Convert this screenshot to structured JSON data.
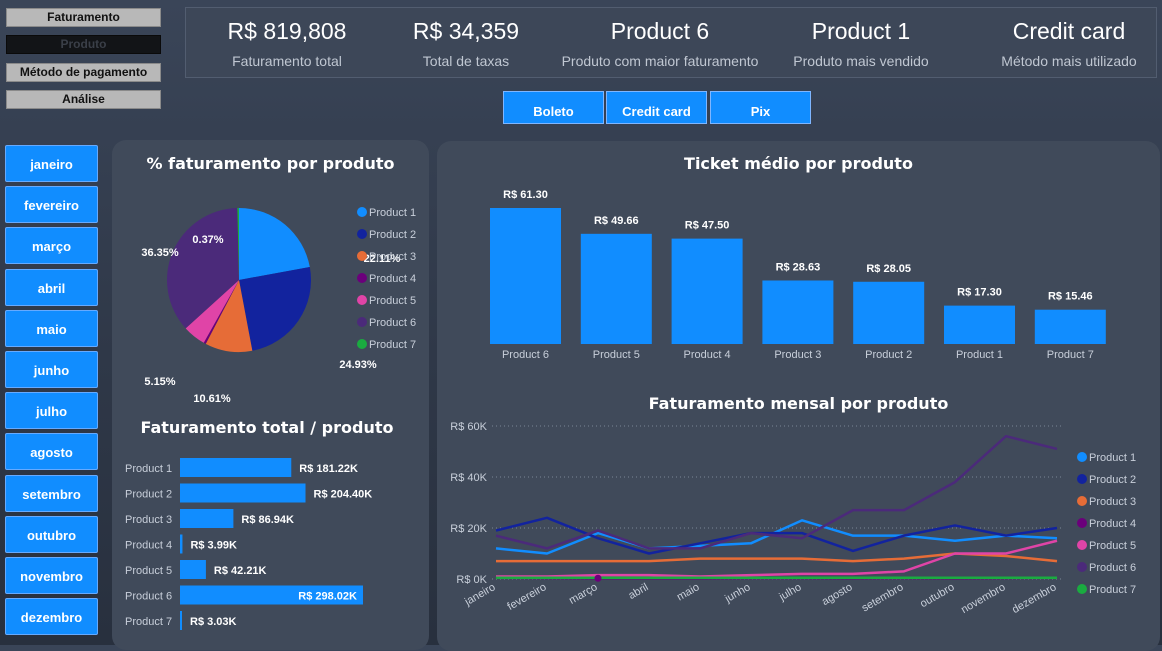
{
  "nav": {
    "items": [
      {
        "label": "Faturamento",
        "active": false
      },
      {
        "label": "Produto",
        "active": true
      },
      {
        "label": "Método de pagamento",
        "active": false
      },
      {
        "label": "Análise",
        "active": false
      }
    ]
  },
  "kpis": [
    {
      "value": "R$ 819,808",
      "label": "Faturamento total"
    },
    {
      "value": "R$ 34,359",
      "label": "Total de taxas"
    },
    {
      "value": "Product 6",
      "label": "Produto com maior faturamento"
    },
    {
      "value": "Product 1",
      "label": "Produto mais vendido"
    },
    {
      "value": "Credit card",
      "label": "Método mais utilizado"
    }
  ],
  "payment_buttons": [
    "Boleto",
    "Credit card",
    "Pix"
  ],
  "months": [
    "janeiro",
    "fevereiro",
    "março",
    "abril",
    "maio",
    "junho",
    "julho",
    "agosto",
    "setembro",
    "outubro",
    "novembro",
    "dezembro"
  ],
  "colors": {
    "Product 1": "#118dff",
    "Product 2": "#12239e",
    "Product 3": "#e66c37",
    "Product 4": "#6b007b",
    "Product 5": "#e044a7",
    "Product 6": "#4b2a7a",
    "Product 7": "#1aab40"
  },
  "chart_data": [
    {
      "type": "pie",
      "title": "% faturamento por produto",
      "legend": [
        "Product 1",
        "Product 2",
        "Product 3",
        "Product 4",
        "Product 5",
        "Product 6",
        "Product 7"
      ],
      "values": [
        22.11,
        24.93,
        10.61,
        0.49,
        5.15,
        36.35,
        0.37
      ],
      "labels": [
        "22.11%",
        "24.93%",
        "10.61%",
        "",
        "5.15%",
        "36.35%",
        "0.37%"
      ],
      "legend_position": "right"
    },
    {
      "type": "bar",
      "orientation": "horizontal",
      "title": "Faturamento total / produto",
      "categories": [
        "Product 1",
        "Product 2",
        "Product 3",
        "Product 4",
        "Product 5",
        "Product 6",
        "Product 7"
      ],
      "values": [
        181.22,
        204.4,
        86.94,
        3.99,
        42.21,
        298.02,
        3.03
      ],
      "labels": [
        "R$ 181.22K",
        "R$ 204.40K",
        "R$ 86.94K",
        "R$ 3.99K",
        "R$ 42.21K",
        "R$ 298.02K",
        "R$ 3.03K"
      ]
    },
    {
      "type": "bar",
      "title": "Ticket médio por produto",
      "categories": [
        "Product 6",
        "Product 5",
        "Product 4",
        "Product 3",
        "Product 2",
        "Product 1",
        "Product 7"
      ],
      "values": [
        61.3,
        49.66,
        47.5,
        28.63,
        28.05,
        17.3,
        15.46
      ],
      "labels": [
        "R$ 61.30",
        "R$ 49.66",
        "R$ 47.50",
        "R$ 28.63",
        "R$ 28.05",
        "R$ 17.30",
        "R$ 15.46"
      ]
    },
    {
      "type": "line",
      "title": "Faturamento mensal por produto",
      "x": [
        "janeiro",
        "fevereiro",
        "março",
        "abril",
        "maio",
        "junho",
        "julho",
        "agosto",
        "setembro",
        "outubro",
        "novembro",
        "dezembro"
      ],
      "yticks": [
        "R$ 0K",
        "R$ 20K",
        "R$ 40K",
        "R$ 60K"
      ],
      "ylim": [
        0,
        60
      ],
      "legend_position": "right",
      "series": [
        {
          "name": "Product 1",
          "values": [
            12,
            10,
            18,
            12,
            13,
            14,
            23,
            17,
            17,
            15,
            17,
            16
          ]
        },
        {
          "name": "Product 2",
          "values": [
            19,
            24,
            16,
            10,
            14,
            18,
            18,
            11,
            17,
            21,
            17,
            20
          ]
        },
        {
          "name": "Product 3",
          "values": [
            7,
            7,
            7,
            7,
            8,
            8,
            8,
            7,
            8,
            10,
            9,
            7
          ]
        },
        {
          "name": "Product 4",
          "values": [
            0.5,
            0.4,
            0.3,
            0.3,
            0.3,
            0.4,
            0.4,
            0.3,
            0.4,
            0.3,
            0.4,
            0.5
          ]
        },
        {
          "name": "Product 5",
          "values": [
            1,
            1,
            1.5,
            1.5,
            1,
            1.5,
            2,
            2,
            3,
            10,
            10,
            15
          ]
        },
        {
          "name": "Product 6",
          "values": [
            17,
            12,
            19,
            12,
            12,
            18,
            16,
            27,
            27,
            38,
            56,
            51
          ]
        },
        {
          "name": "Product 7",
          "values": [
            0.5,
            0.5,
            0.5,
            0.5,
            0.5,
            0.5,
            0.5,
            0.5,
            0.5,
            0.5,
            0.5,
            0.5
          ]
        }
      ]
    }
  ]
}
